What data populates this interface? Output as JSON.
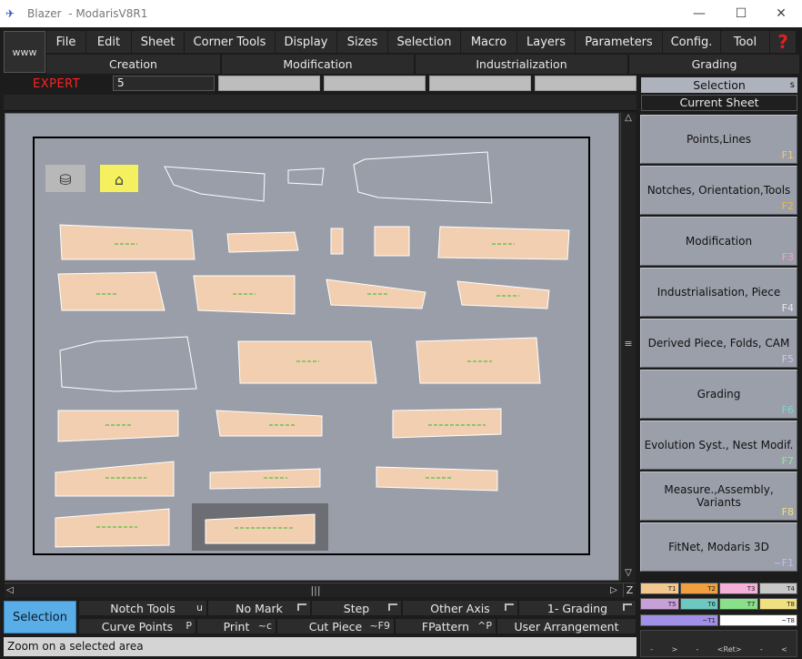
{
  "window": {
    "app_name": "Blazer",
    "title": "- ModarisV8R1"
  },
  "www_label": "www",
  "menu": [
    {
      "label": "File",
      "w": 44
    },
    {
      "label": "Edit",
      "w": 50
    },
    {
      "label": "Sheet",
      "w": 58
    },
    {
      "label": "Corner Tools",
      "w": 100
    },
    {
      "label": "Display",
      "w": 68
    },
    {
      "label": "Sizes",
      "w": 56
    },
    {
      "label": "Selection",
      "w": 80
    },
    {
      "label": "Macro",
      "w": 62
    },
    {
      "label": "Layers",
      "w": 64
    },
    {
      "label": "Parameters",
      "w": 96
    },
    {
      "label": "Config.",
      "w": 64
    },
    {
      "label": "Tool",
      "w": 54
    }
  ],
  "submenu": [
    "Creation",
    "Modification",
    "Industrialization",
    "Grading"
  ],
  "mode_label": "EXPERT",
  "input_value": "5",
  "panel": {
    "selection_label": "Selection",
    "selection_key": "s",
    "current_sheet": "Current Sheet"
  },
  "fkeys": [
    {
      "label": "Points,Lines",
      "key": "F1",
      "color": "#f4c66e"
    },
    {
      "label": "Notches, Orientation,Tools",
      "key": "F2",
      "color": "#f4b544"
    },
    {
      "label": "Modification",
      "key": "F3",
      "color": "#f3a3c8"
    },
    {
      "label": "Industrialisation, Piece",
      "key": "F4",
      "color": "#e8e8e8"
    },
    {
      "label": "Derived Piece, Folds, CAM",
      "key": "F5",
      "color": "#d7c0ee"
    },
    {
      "label": "Grading",
      "key": "F6",
      "color": "#78d8d0"
    },
    {
      "label": "Evolution Syst., Nest Modif.",
      "key": "F7",
      "color": "#90e890"
    },
    {
      "label": "Measure.,Assembly, Variants",
      "key": "F8",
      "color": "#f0e080"
    },
    {
      "label": "FitNet, Modaris 3D",
      "key": "~F1",
      "color": "#c8b8f8"
    }
  ],
  "swatches_row1": [
    {
      "label": "T1",
      "color": "#f2c890"
    },
    {
      "label": "T2",
      "color": "#f0a040"
    },
    {
      "label": "T3",
      "color": "#f4b0d8"
    },
    {
      "label": "T4",
      "color": "#c8c8c8"
    }
  ],
  "swatches_row2": [
    {
      "label": "T5",
      "color": "#c8a0d8"
    },
    {
      "label": "T6",
      "color": "#6cc8c0"
    },
    {
      "label": "T7",
      "color": "#88e088"
    },
    {
      "label": "T8",
      "color": "#f0e080"
    }
  ],
  "swatches_row3": [
    {
      "label": "~T1",
      "color": "#a090e8"
    },
    {
      "label": "~T8",
      "color": "#ffffff"
    }
  ],
  "bottom_right_labels": [
    "-",
    ">",
    "-",
    "<Ret>",
    "-",
    "<"
  ],
  "bottom_tools": {
    "selection": "Selection",
    "row1": [
      {
        "label": "Notch Tools",
        "key": "u"
      },
      {
        "label": "No Mark",
        "flag": true
      },
      {
        "label": "Step",
        "flag": true
      },
      {
        "label": "Other Axis",
        "flag": true
      },
      {
        "label": "1- Grading",
        "flag": true
      }
    ],
    "row2": [
      {
        "label": "Curve Points",
        "key": "P"
      },
      {
        "label": "Print",
        "key": "~c"
      },
      {
        "label": "Cut Piece",
        "key": "~F9"
      },
      {
        "label": "FPattern",
        "key": "^P"
      },
      {
        "label": "User Arrangement"
      }
    ]
  },
  "status": "Zoom on a selected area"
}
